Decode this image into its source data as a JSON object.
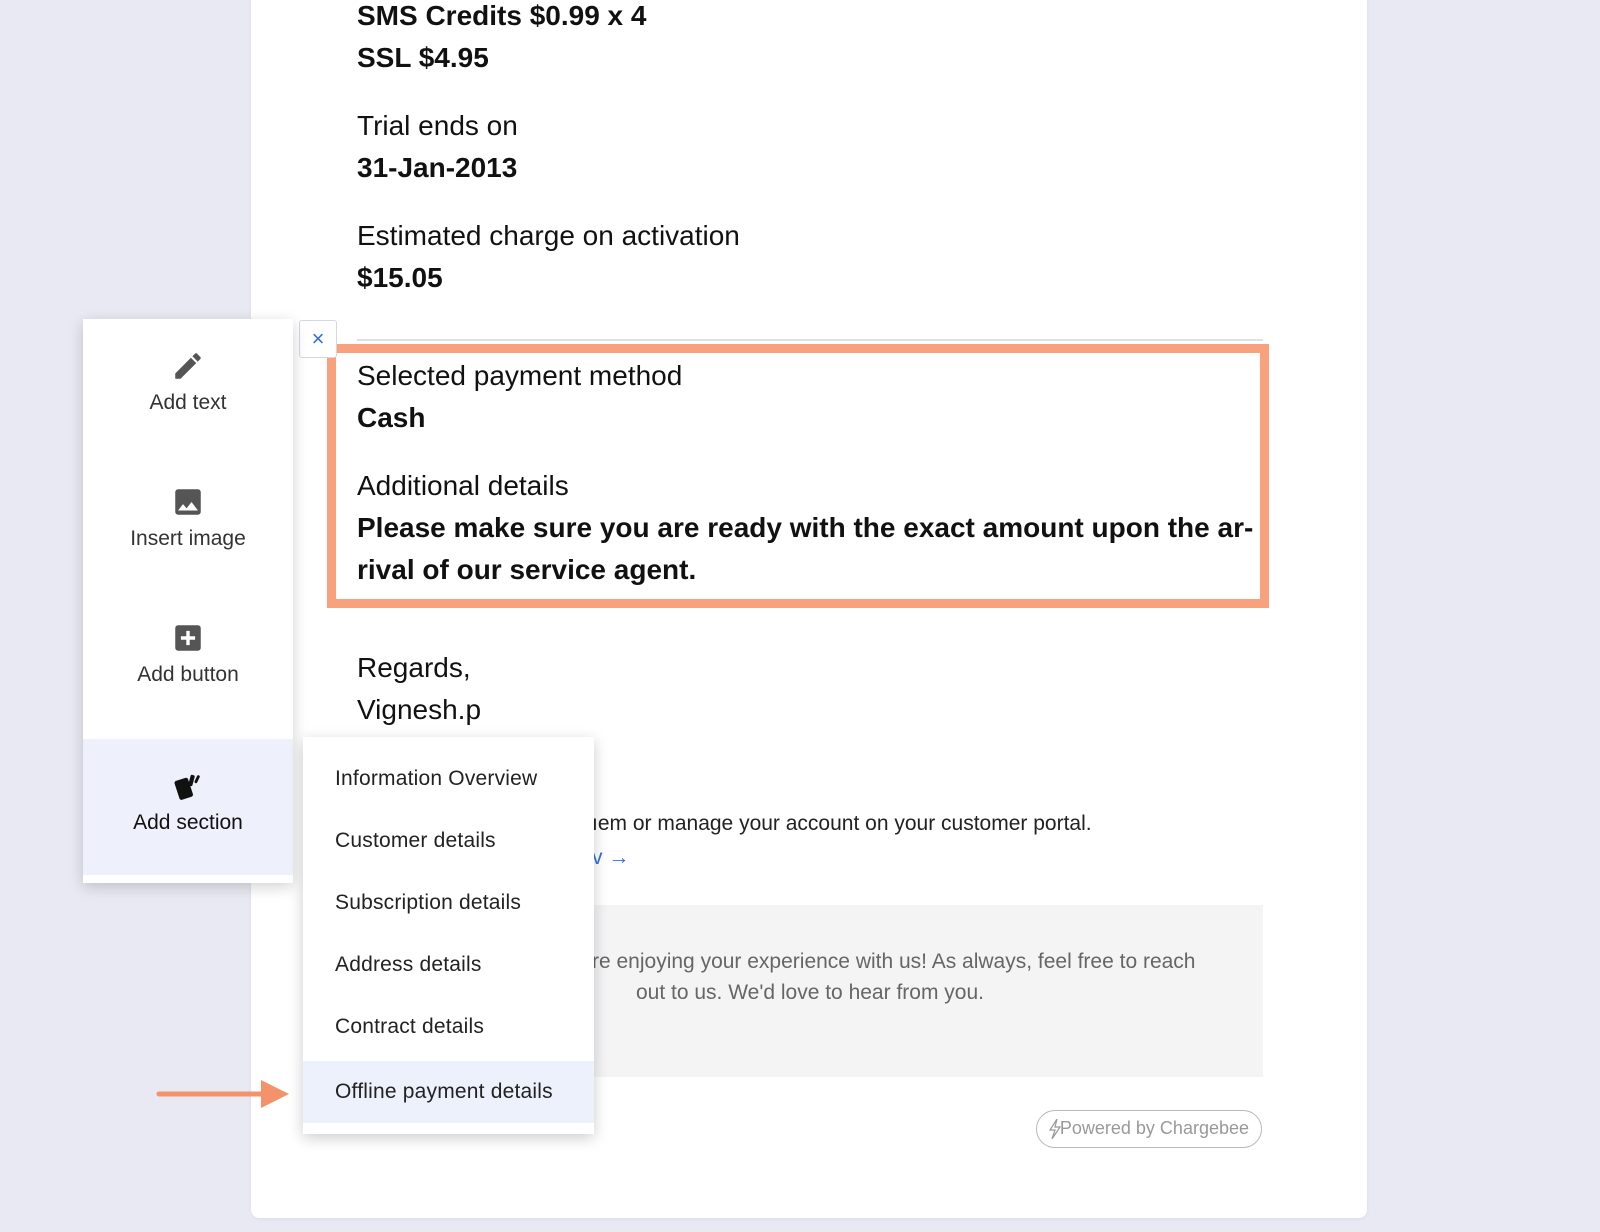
{
  "email": {
    "sms_credits": "SMS Credits $0.99 x 4",
    "ssl": "SSL $4.95",
    "trial_label": "Trial ends on",
    "trial_date": "31-Jan-2013",
    "estimate_label": "Estimated charge on activation",
    "estimate_value": "$15.05",
    "payment_label": "Selected payment method",
    "payment_value": "Cash",
    "additional_label": "Additional details",
    "additional_line1": "Please make sure you are ready with the exact amount upon the ar-",
    "additional_line2": "rival of our service agent.",
    "regards": "Regards,",
    "signature": "Vignesh.p",
    "portal_text": "ıem or manage your account on your customer portal.",
    "portal_link": "v →",
    "footer_line1": "re enjoying your experience with us! As always, feel free to reach",
    "footer_line2": "out to us. We'd love to hear from you.",
    "powered": "Powered by Chargebee"
  },
  "close_label": "×",
  "toolbar": {
    "items": [
      {
        "label": "Add text",
        "icon": "pencil-icon"
      },
      {
        "label": "Insert image",
        "icon": "image-icon"
      },
      {
        "label": "Add button",
        "icon": "plus-square-icon"
      },
      {
        "label": "Add section",
        "icon": "cards-icon"
      }
    ]
  },
  "dropdown": {
    "items": [
      "Information Overview",
      "Customer details",
      "Subscription details",
      "Address details",
      "Contract details",
      "Offline payment details"
    ],
    "selected": "Offline payment details"
  },
  "colors": {
    "highlight": "#f9a07d",
    "link": "#2f6fd9",
    "active_bg": "#edf1fc"
  }
}
